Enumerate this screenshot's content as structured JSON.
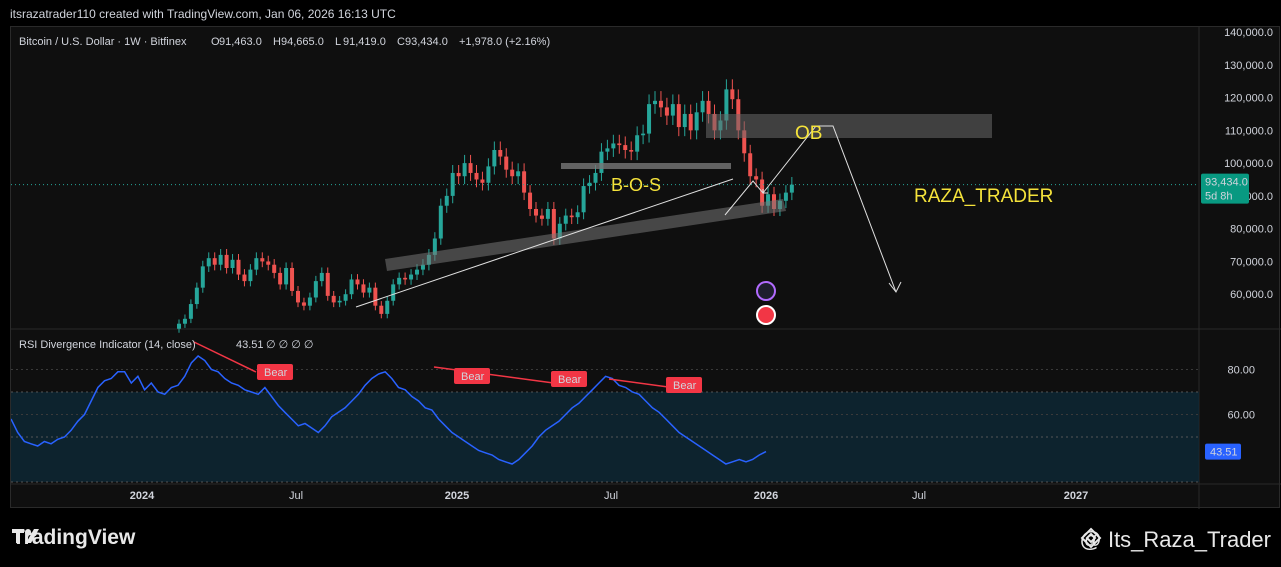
{
  "header": {
    "attribution": "itsrazatrader110 created with TradingView.com, Jan 06, 2026 16:13 UTC"
  },
  "legend": {
    "symbol": "Bitcoin / U.S. Dollar · 1W · Bitfinex",
    "o_label": "O",
    "o_value": "91,463.0",
    "h_label": "H",
    "h_value": "94,665.0",
    "l_label": "L",
    "l_value": "91,419.0",
    "c_label": "C",
    "c_value": "93,434.0",
    "change": "+1,978.0 (+2.16%)"
  },
  "indicator": {
    "name": "RSI Divergence Indicator (14, close)",
    "value": "43.51",
    "extras": "∅ ∅ ∅ ∅"
  },
  "price_badge": {
    "price": "93,434.0",
    "countdown": "5d 8h"
  },
  "rsi_badge": "43.51",
  "annotations": {
    "ob": "OB",
    "bos": "B-O-S",
    "watermark": "RAZA_TRADER",
    "bear": "Bear"
  },
  "footer": {
    "logo": "TradingView",
    "handle": "@ Its_Raza_Trader"
  },
  "colors": {
    "up": "#26a69a",
    "down": "#ef5350",
    "rsi": "#2962ff",
    "bear": "#f23645",
    "text_yellow": "#f5e33b"
  },
  "chart_data": {
    "type": "candlestick",
    "title": "Bitcoin / U.S. Dollar · 1W · Bitfinex",
    "price_axis": {
      "min": 50000,
      "max": 140000,
      "ticks": [
        "140,000.0",
        "130,000.0",
        "120,000.0",
        "110,000.0",
        "100,000.0",
        "90,000.0",
        "80,000.0",
        "70,000.0",
        "60,000.0"
      ]
    },
    "time_axis": {
      "ticks": [
        "2024",
        "Jul",
        "2025",
        "Jul",
        "2026",
        "Jul",
        "2027"
      ]
    },
    "weekly_closes": [
      51000,
      52500,
      57000,
      62000,
      68500,
      71000,
      69000,
      72000,
      68000,
      70500,
      66000,
      64000,
      67500,
      71000,
      70000,
      69000,
      66500,
      63000,
      68000,
      61000,
      57500,
      56500,
      59000,
      64000,
      66500,
      59500,
      57500,
      58000,
      60000,
      64500,
      63000,
      60500,
      62000,
      56500,
      54000,
      58000,
      63000,
      65000,
      64500,
      66000,
      67500,
      69000,
      72000,
      77000,
      87000,
      90000,
      97000,
      96000,
      100000,
      97000,
      95000,
      94000,
      99000,
      104000,
      102000,
      98000,
      96000,
      97500,
      91000,
      86000,
      84000,
      83000,
      86000,
      77000,
      81500,
      84000,
      83500,
      85000,
      93000,
      94000,
      97000,
      103500,
      104500,
      106000,
      105500,
      104000,
      103500,
      108500,
      109000,
      118000,
      119000,
      117000,
      114500,
      118000,
      111000,
      115000,
      110000,
      115500,
      119000,
      115000,
      110000,
      113000,
      122500,
      119500,
      110000,
      103000,
      96000,
      95000,
      87000,
      90500,
      86000,
      88500,
      91000,
      93434
    ],
    "rsi": [
      58,
      52,
      48,
      47,
      46,
      48,
      47,
      49,
      50,
      53,
      57,
      60,
      66,
      72,
      75,
      76,
      79,
      79,
      74,
      77,
      71,
      74,
      70,
      69,
      72,
      73,
      77,
      83,
      86,
      84,
      80,
      79,
      76,
      74,
      73,
      71,
      70,
      69,
      72,
      68,
      64,
      61,
      58,
      55,
      56,
      54,
      52,
      55,
      59,
      61,
      63,
      66,
      69,
      73,
      76,
      78,
      79,
      76,
      72,
      71,
      68,
      66,
      63,
      62,
      58,
      55,
      52,
      50,
      48,
      46,
      44,
      43,
      42,
      40,
      39,
      38,
      40,
      43,
      46,
      50,
      53,
      55,
      57,
      60,
      63,
      65,
      68,
      71,
      74,
      77,
      76,
      73,
      72,
      70,
      69,
      66,
      63,
      61,
      58,
      55,
      52,
      50,
      48,
      46,
      44,
      42,
      40,
      38,
      39,
      40,
      39,
      40,
      42,
      43.51
    ]
  }
}
